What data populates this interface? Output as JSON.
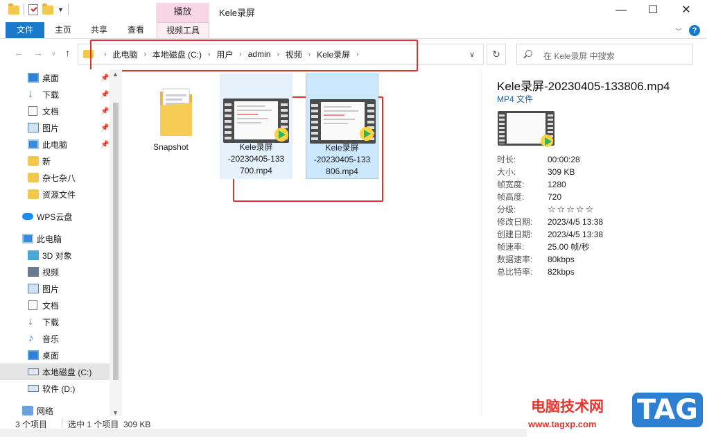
{
  "window": {
    "title": "Kele录屏",
    "context_tab": "播放",
    "controls": {
      "minimize": "—",
      "maximize": "☐",
      "close": "✕"
    }
  },
  "ribbon": {
    "tabs": [
      "文件",
      "主页",
      "共享",
      "查看",
      "视频工具"
    ],
    "help": "?"
  },
  "address": {
    "crumbs": [
      "此电脑",
      "本地磁盘 (C:)",
      "用户",
      "admin",
      "视频",
      "Kele录屏"
    ],
    "search_placeholder": "在 Kele录屏 中搜索"
  },
  "sidebar": {
    "items": [
      {
        "label": "桌面",
        "icon": "desktop-icon",
        "pinned": true
      },
      {
        "label": "下载",
        "icon": "download-icon",
        "pinned": true
      },
      {
        "label": "文档",
        "icon": "document-icon",
        "pinned": true
      },
      {
        "label": "图片",
        "icon": "picture-icon",
        "pinned": true
      },
      {
        "label": "此电脑",
        "icon": "computer-icon",
        "pinned": true
      },
      {
        "label": "新",
        "icon": "folder-icon"
      },
      {
        "label": "杂七杂八",
        "icon": "folder-icon"
      },
      {
        "label": "资源文件",
        "icon": "folder-icon"
      },
      {
        "label": "WPS云盘",
        "icon": "cloud-icon"
      },
      {
        "label": "此电脑",
        "icon": "computer-icon"
      },
      {
        "label": "3D 对象",
        "icon": "3d-objects-icon"
      },
      {
        "label": "视频",
        "icon": "video-icon"
      },
      {
        "label": "图片",
        "icon": "picture-icon"
      },
      {
        "label": "文档",
        "icon": "document-icon"
      },
      {
        "label": "下载",
        "icon": "download-icon"
      },
      {
        "label": "音乐",
        "icon": "music-icon"
      },
      {
        "label": "桌面",
        "icon": "desktop-icon"
      },
      {
        "label": "本地磁盘 (C:)",
        "icon": "drive-icon",
        "selected": true
      },
      {
        "label": "软件 (D:)",
        "icon": "drive-icon"
      },
      {
        "label": "网络",
        "icon": "network-icon"
      }
    ]
  },
  "files": [
    {
      "name": "Snapshot",
      "type": "folder"
    },
    {
      "name": "Kele录屏\n-20230405-133\n700.mp4",
      "type": "video"
    },
    {
      "name": "Kele录屏\n-20230405-133\n806.mp4",
      "type": "video",
      "selected": true
    }
  ],
  "details": {
    "title": "Kele录屏-20230405-133806.mp4",
    "type": "MP4 文件",
    "props": [
      {
        "k": "时长:",
        "v": "00:00:28"
      },
      {
        "k": "大小:",
        "v": "309 KB"
      },
      {
        "k": "帧宽度:",
        "v": "1280"
      },
      {
        "k": "帧高度:",
        "v": "720"
      },
      {
        "k": "分级:",
        "v": "☆☆☆☆☆"
      },
      {
        "k": "修改日期:",
        "v": "2023/4/5 13:38"
      },
      {
        "k": "创建日期:",
        "v": "2023/4/5 13:38"
      },
      {
        "k": "帧速率:",
        "v": "25.00 帧/秒"
      },
      {
        "k": "数据速率:",
        "v": "80kbps"
      },
      {
        "k": "总比特率:",
        "v": "82kbps"
      }
    ]
  },
  "status": {
    "count": "3 个项目",
    "selection": "选中 1 个项目  309 KB"
  },
  "watermark": {
    "site_name": "电脑技术网",
    "url": "www.tagxp.com",
    "tag": "TAG"
  },
  "colors": {
    "accent": "#1979ca",
    "selection": "#cce8ff",
    "highlight_box": "#e0332f",
    "context_tab": "#f9d6e5"
  }
}
